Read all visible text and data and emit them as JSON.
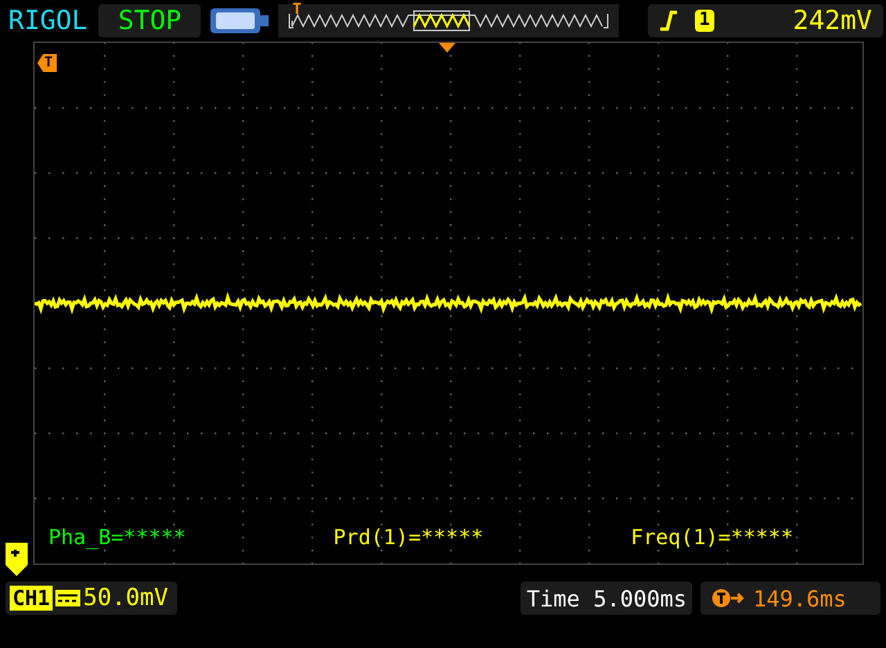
{
  "brand": "RIGOL",
  "run_state": "STOP",
  "overview": {
    "trigger_mark": "T"
  },
  "trigger": {
    "source": "1",
    "level": "242mV"
  },
  "grid": {
    "trigger_level_mark": "T"
  },
  "measurements": [
    {
      "text": "Pha_B=*****",
      "color": "#00ff00"
    },
    {
      "text": "Prd(1)=*****",
      "color": "#ffff00"
    },
    {
      "text": "Freq(1)=*****",
      "color": "#ffff00"
    }
  ],
  "channel": {
    "label": "CH1",
    "scale": "50.0mV"
  },
  "timebase": {
    "label": "Time",
    "value": "5.000ms"
  },
  "trigger_offset": "149.6ms"
}
